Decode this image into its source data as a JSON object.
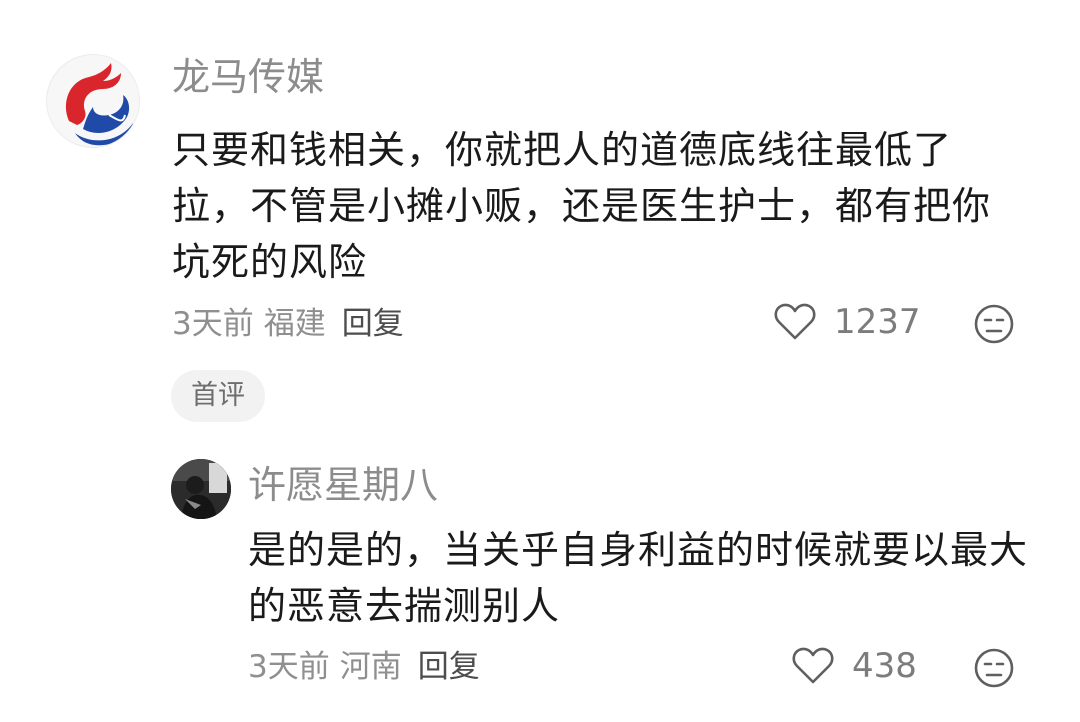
{
  "main_comment": {
    "avatar_icon": "dragon-logo-icon",
    "username": "龙马传媒",
    "text": "只要和钱相关，你就把人的道德底线往最低了拉，不管是小摊小贩，还是医生护士，都有把你坑死的风险",
    "time": "3天前",
    "location": "福建",
    "reply_label": "回复",
    "like_count": "1237",
    "badge": "首评"
  },
  "reply_comment": {
    "avatar_icon": "user-photo-avatar",
    "username": "许愿星期八",
    "text": "是的是的，当关乎自身利益的时候就要以最大的恶意去揣测别人",
    "time": "3天前",
    "location": "河南",
    "reply_label": "回复",
    "like_count": "438"
  },
  "colors": {
    "username": "#8c8c8c",
    "text": "#1a1a1a",
    "meta": "#8f8f8f",
    "badge_bg": "#f2f2f2",
    "logo_red": "#d9262c",
    "logo_blue": "#1f4aa8"
  }
}
